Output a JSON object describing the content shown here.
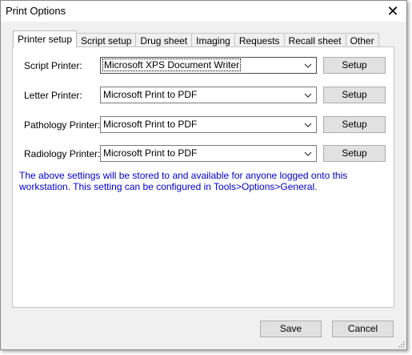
{
  "window": {
    "title": "Print Options"
  },
  "tabs": [
    {
      "label": "Printer setup",
      "active": true
    },
    {
      "label": "Script setup"
    },
    {
      "label": "Drug sheet"
    },
    {
      "label": "Imaging"
    },
    {
      "label": "Requests"
    },
    {
      "label": "Recall sheet"
    },
    {
      "label": "Other"
    }
  ],
  "printers": [
    {
      "label": "Script Printer:",
      "value": "Microsoft XPS Document Writer",
      "button": "Setup"
    },
    {
      "label": "Letter Printer:",
      "value": "Microsoft Print to PDF",
      "button": "Setup"
    },
    {
      "label": "Pathology Printer:",
      "value": "Microsoft Print to PDF",
      "button": "Setup"
    },
    {
      "label": "Radiology Printer:",
      "value": "Microsoft Print to PDF",
      "button": "Setup"
    }
  ],
  "info_text": "The above settings will be stored to and available for anyone logged onto this workstation. This setting can be configured in Tools>Options>General.",
  "footer": {
    "save": "Save",
    "cancel": "Cancel"
  },
  "colors": {
    "info": "#0000cc",
    "window_bg": "#f0f0f0"
  },
  "icons": {
    "close": "close-icon",
    "dropdown": "chevron-down-icon",
    "resize": "resize-grip-icon"
  }
}
